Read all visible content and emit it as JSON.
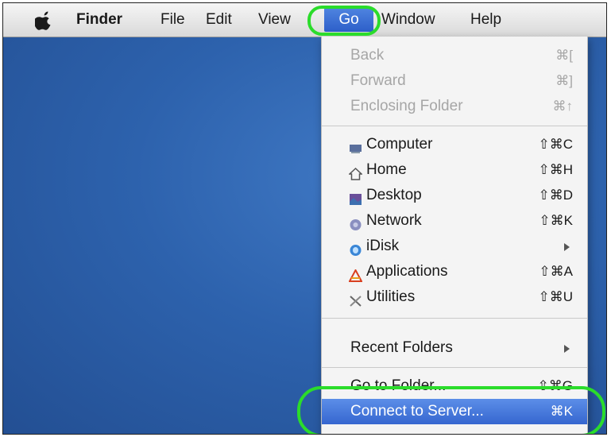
{
  "menubar": {
    "apple": "apple-icon",
    "items": [
      "Finder",
      "File",
      "Edit",
      "View",
      "Go",
      "Window",
      "Help"
    ]
  },
  "go_menu": {
    "nav": [
      {
        "label": "Back",
        "shortcut": "⌘["
      },
      {
        "label": "Forward",
        "shortcut": "⌘]"
      },
      {
        "label": "Enclosing Folder",
        "shortcut": "⌘↑"
      }
    ],
    "places": [
      {
        "label": "Computer",
        "shortcut": "⇧⌘C",
        "icon": "computer-icon"
      },
      {
        "label": "Home",
        "shortcut": "⇧⌘H",
        "icon": "home-icon"
      },
      {
        "label": "Desktop",
        "shortcut": "⇧⌘D",
        "icon": "desktop-icon"
      },
      {
        "label": "Network",
        "shortcut": "⇧⌘K",
        "icon": "network-icon"
      },
      {
        "label": "iDisk",
        "shortcut": "",
        "icon": "idisk-icon"
      },
      {
        "label": "Applications",
        "shortcut": "⇧⌘A",
        "icon": "applications-icon"
      },
      {
        "label": "Utilities",
        "shortcut": "⇧⌘U",
        "icon": "utilities-icon"
      }
    ],
    "recent": {
      "label": "Recent Folders"
    },
    "go_to_folder": {
      "label": "Go to Folder...",
      "shortcut": "⇧⌘G"
    },
    "connect": {
      "label": "Connect to Server...",
      "shortcut": "⌘K"
    }
  },
  "colors": {
    "highlight": "#3566cf",
    "annotation": "#2bdc2b",
    "desktop": "#2d62ad"
  }
}
